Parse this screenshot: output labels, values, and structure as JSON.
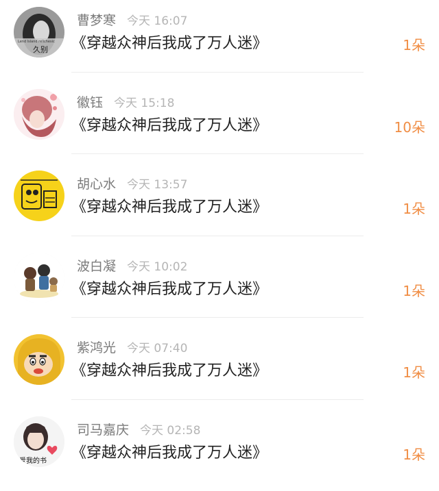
{
  "messages": [
    {
      "name": "曹梦寒",
      "time": "今天 16:07",
      "title": "《穿越众神后我成了万人迷》",
      "count": "1朵",
      "avatar": "avatar-gray-portrait"
    },
    {
      "name": "徽钰",
      "time": "今天 15:18",
      "title": "《穿越众神后我成了万人迷》",
      "count": "10朵",
      "avatar": "avatar-floral-girl"
    },
    {
      "name": "胡心水",
      "time": "今天 13:57",
      "title": "《穿越众神后我成了万人迷》",
      "count": "1朵",
      "avatar": "avatar-yellow-cartoon"
    },
    {
      "name": "波白凝",
      "time": "今天 10:02",
      "title": "《穿越众神后我成了万人迷》",
      "count": "1朵",
      "avatar": "avatar-chibi-group"
    },
    {
      "name": "紫鸿光",
      "time": "今天 07:40",
      "title": "《穿越众神后我成了万人迷》",
      "count": "1朵",
      "avatar": "avatar-crayon-kid"
    },
    {
      "name": "司马嘉庆",
      "time": "今天 02:58",
      "title": "《穿越众神后我成了万人迷》",
      "count": "1朵",
      "avatar": "avatar-girl-heart"
    }
  ],
  "avatar_text": {
    "a0": "Lend Island relichesic",
    "a0b": "久别",
    "a5": "爱我的书"
  }
}
